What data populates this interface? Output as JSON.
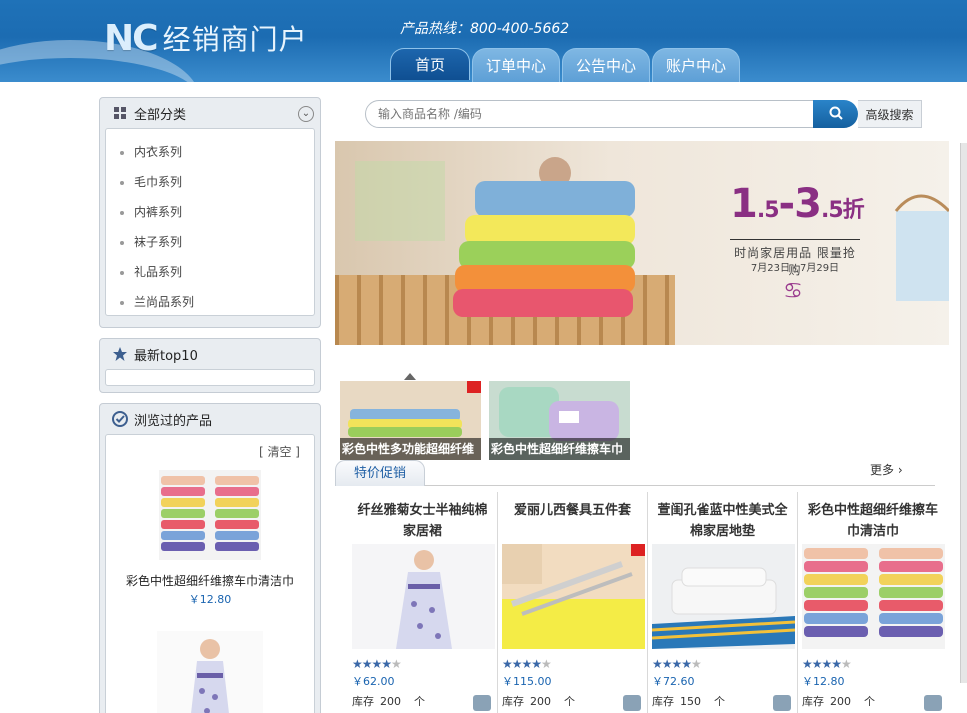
{
  "header": {
    "logo_mark": "NC",
    "logo_text": "经销商门户",
    "hotline": "产品热线：800-400-5662",
    "nav": [
      {
        "label": "首页",
        "active": true
      },
      {
        "label": "订单中心",
        "active": false
      },
      {
        "label": "公告中心",
        "active": false
      },
      {
        "label": "账户中心",
        "active": false
      }
    ]
  },
  "sidebar": {
    "categories": {
      "title": "全部分类",
      "items": [
        "内衣系列",
        "毛巾系列",
        "内裤系列",
        "袜子系列",
        "礼品系列",
        "兰尚品系列"
      ]
    },
    "top10": {
      "title": "最新top10"
    },
    "browsed": {
      "title": "浏览过的产品",
      "clear_label": "[ 清空 ]",
      "items": [
        {
          "name": "彩色中性超细纤维擦车巾清洁巾",
          "price": "￥12.80"
        }
      ]
    }
  },
  "search": {
    "placeholder": "输入商品名称 /编码",
    "advanced_label": "高级搜索"
  },
  "banner": {
    "discount_from": "1",
    "discount_from_dec": ".5",
    "discount_sep": "-",
    "discount_to": "3",
    "discount_to_dec": ".5",
    "discount_unit": "折",
    "subtitle": "时尚家居用品  限量抢购",
    "date_range": "7月23日 - 7月29日"
  },
  "thumbnails": [
    {
      "caption": "彩色中性多功能超细纤维"
    },
    {
      "caption": "彩色中性超细纤维擦车巾"
    }
  ],
  "specials": {
    "tab_label": "特价促销",
    "more_label": "更多",
    "products": [
      {
        "name": "纤丝雅菊女士半袖纯棉家居裙",
        "price": "￥62.00",
        "stock_label": "库存",
        "stock": "200",
        "unit": "个",
        "rating": 4
      },
      {
        "name": "爱丽儿西餐具五件套",
        "price": "￥115.00",
        "stock_label": "库存",
        "stock": "200",
        "unit": "个",
        "rating": 4
      },
      {
        "name": "萱闺孔雀蓝中性美式全棉家居地垫",
        "price": "￥72.60",
        "stock_label": "库存",
        "stock": "150",
        "unit": "个",
        "rating": 4
      },
      {
        "name": "彩色中性超细纤维擦车巾清洁巾",
        "price": "￥12.80",
        "stock_label": "库存",
        "stock": "200",
        "unit": "个",
        "rating": 4
      }
    ]
  },
  "colors": {
    "header_blue": "#1f72b8",
    "price_blue": "#1a64b0",
    "accent_purple": "#8a2f83"
  }
}
